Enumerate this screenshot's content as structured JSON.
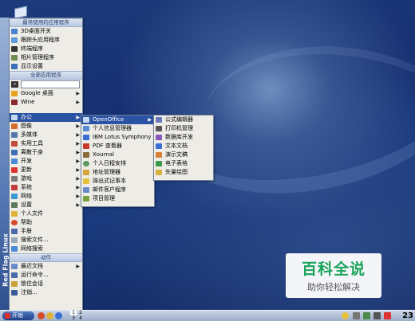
{
  "colors": {
    "menu_highlight": "#2b53a3",
    "watermark_green": "#1aa35a",
    "desktop_blue": "#1d3a7a"
  },
  "desktop": {
    "icon": "book-icon"
  },
  "side_bar": {
    "label": "Red Flag Linux"
  },
  "main_menu": {
    "favorites_header": "最常使用的应用程序",
    "favorites": [
      {
        "label": "3D桌面开关",
        "icon": "cube-icon"
      },
      {
        "label": "跟踪头应用程序",
        "icon": "app-icon"
      },
      {
        "label": "终端程序",
        "icon": "terminal-icon"
      },
      {
        "label": "相片管理程序",
        "icon": "photo-icon"
      },
      {
        "label": "显示设置",
        "icon": "display-icon"
      }
    ],
    "all_header": "全部应用程序",
    "search_placeholder": "",
    "apps": [
      {
        "label": "Google 桌面",
        "arrow": "▶"
      },
      {
        "label": "Wine",
        "arrow": "▶"
      },
      {
        "label": "",
        "arrow": ""
      },
      {
        "label": "办公",
        "arrow": "▶"
      },
      {
        "label": "图像",
        "arrow": "▶"
      },
      {
        "label": "多媒体",
        "arrow": "▶"
      },
      {
        "label": "实用工具",
        "arrow": "▶"
      },
      {
        "label": "离散于身",
        "arrow": "▶"
      },
      {
        "label": "开发",
        "arrow": "▶"
      },
      {
        "label": "更新",
        "arrow": "▶"
      },
      {
        "label": "游戏",
        "arrow": "▶"
      },
      {
        "label": "系统",
        "arrow": "▶"
      },
      {
        "label": "网络",
        "arrow": "▶"
      },
      {
        "label": "设置",
        "arrow": "▶"
      },
      {
        "label": "个人文件",
        "arrow": ""
      },
      {
        "label": "帮助",
        "arrow": ""
      },
      {
        "label": "手册",
        "arrow": ""
      },
      {
        "label": "搜索文件...",
        "arrow": ""
      },
      {
        "label": "网络搜索",
        "arrow": ""
      }
    ],
    "actions_header": "动作",
    "actions": [
      {
        "label": "最近文档",
        "arrow": "▶"
      },
      {
        "label": "运行命令...",
        "arrow": ""
      },
      {
        "label": "锁住会话",
        "arrow": ""
      },
      {
        "label": "注销...",
        "arrow": ""
      }
    ]
  },
  "office_menu": [
    {
      "label": "OpenOffice",
      "arrow": "▶"
    },
    {
      "label": "个人信息管理器",
      "arrow": ""
    },
    {
      "label": "IBM Lotus Symphony",
      "arrow": ""
    },
    {
      "label": "PDF 查看器",
      "arrow": ""
    },
    {
      "label": "Xournal",
      "arrow": ""
    },
    {
      "label": "个人日程安排",
      "arrow": ""
    },
    {
      "label": "地址管理器",
      "arrow": ""
    },
    {
      "label": "弹出式记事本",
      "arrow": ""
    },
    {
      "label": "邮件客户程序",
      "arrow": ""
    },
    {
      "label": "项目管理",
      "arrow": ""
    }
  ],
  "openoffice_menu": [
    {
      "label": "公式编辑器"
    },
    {
      "label": "打印机管理"
    },
    {
      "label": "数据库开发"
    },
    {
      "label": "文本文档"
    },
    {
      "label": "演示文稿"
    },
    {
      "label": "电子表格"
    },
    {
      "label": "矢量绘图"
    }
  ],
  "taskbar": {
    "start_label": "开始",
    "pager": [
      "1",
      "2",
      "3",
      "4"
    ],
    "clock": "23"
  },
  "watermark": {
    "title": "百科全说",
    "subtitle": "助你轻松解决"
  }
}
